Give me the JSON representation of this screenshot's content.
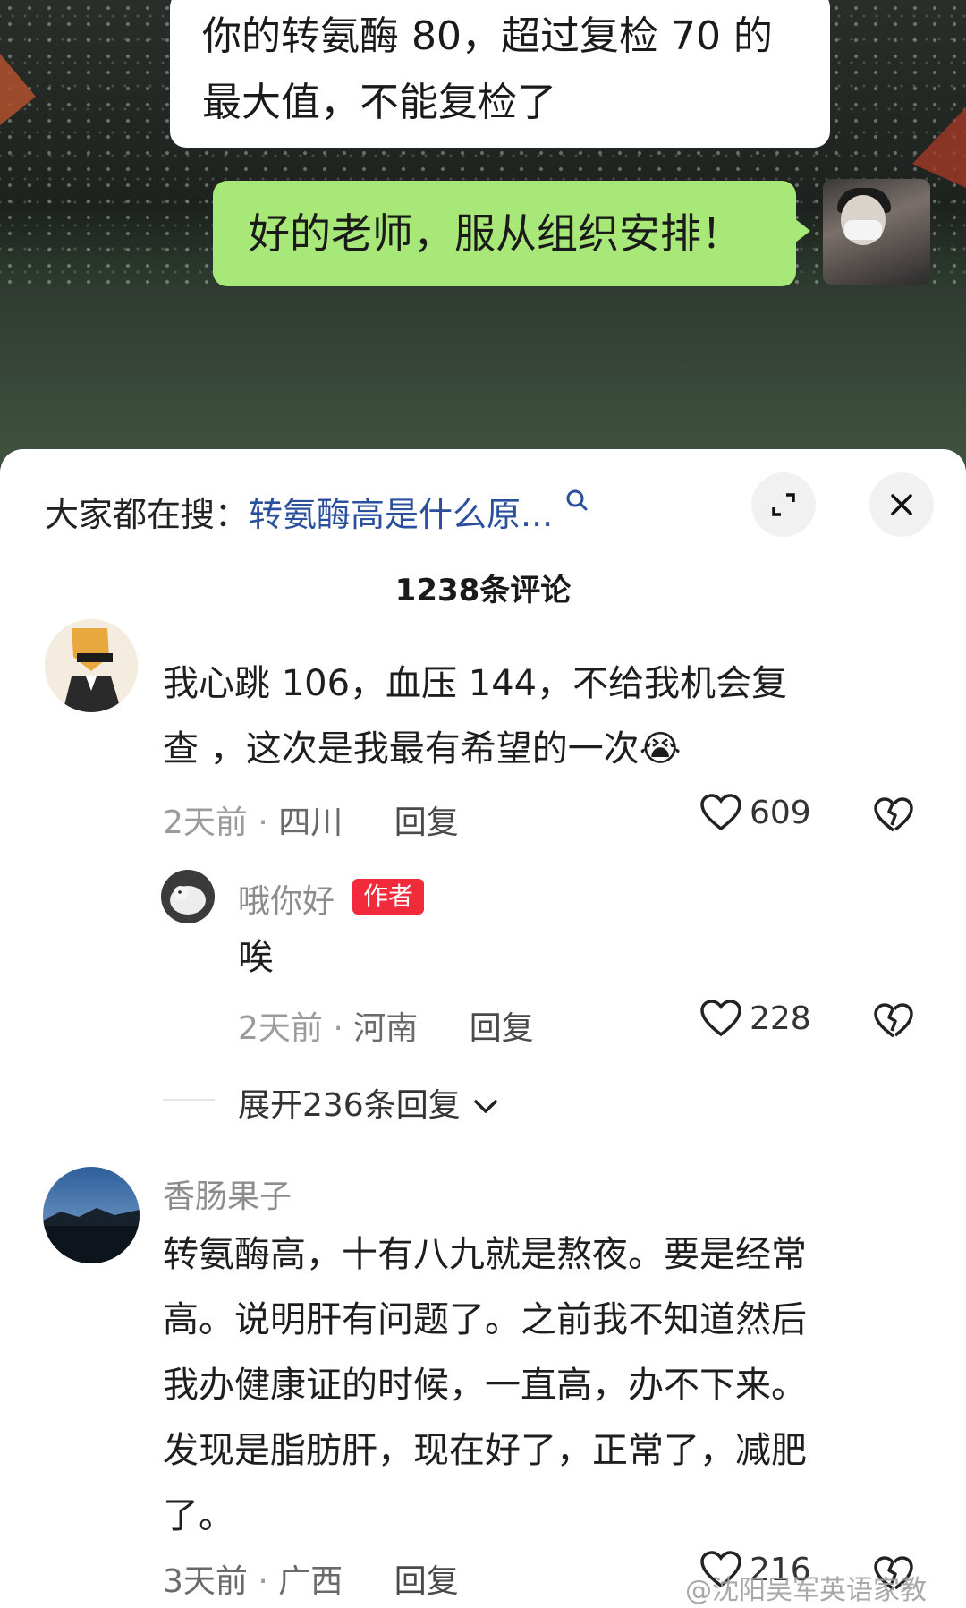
{
  "chat": {
    "message_1": "你的转氨酶 80，超过复检 70 的最大值，不能复检了",
    "message_1_line1": "你的转氨酶 80，超过复检 70 的",
    "message_1_line2": "最大值，不能复检了",
    "message_2": "好的老师，服从组织安排！"
  },
  "search": {
    "prefix": "大家都在搜：",
    "term": "转氨酶高是什么原..."
  },
  "comments_header": {
    "count_label": "1238条评论"
  },
  "comments": [
    {
      "text_line1": "我心跳 106，血压 144，不给我机会复",
      "text_line2": "查 ，这次是我最有希望的一次",
      "emoji": "😭",
      "time": "2天前",
      "location": "四川",
      "reply_label": "回复",
      "likes": "609"
    },
    {
      "username": "香肠果子",
      "text_line1": "转氨酶高，十有八九就是熬夜。要是经常",
      "text_line2": "高。说明肝有问题了。之前我不知道然后",
      "text_line3": "我办健康证的时候，一直高，办不下来。",
      "text_line4": "发现是脂肪肝，现在好了，正常了，减肥",
      "text_line5": "了。",
      "time": "3天前",
      "location": "广西",
      "reply_label": "回复",
      "likes": "216"
    }
  ],
  "author_reply": {
    "username": "哦你好",
    "badge": "作者",
    "text": "唉",
    "time": "2天前",
    "location": "河南",
    "reply_label": "回复",
    "likes": "228"
  },
  "expand_replies": {
    "label": "展开236条回复"
  },
  "watermark": "@沈阳吴军英语家教",
  "colors": {
    "link_blue": "#2a4f9c",
    "badge_red": "#f12b3c",
    "chat_green": "#a8e878"
  }
}
